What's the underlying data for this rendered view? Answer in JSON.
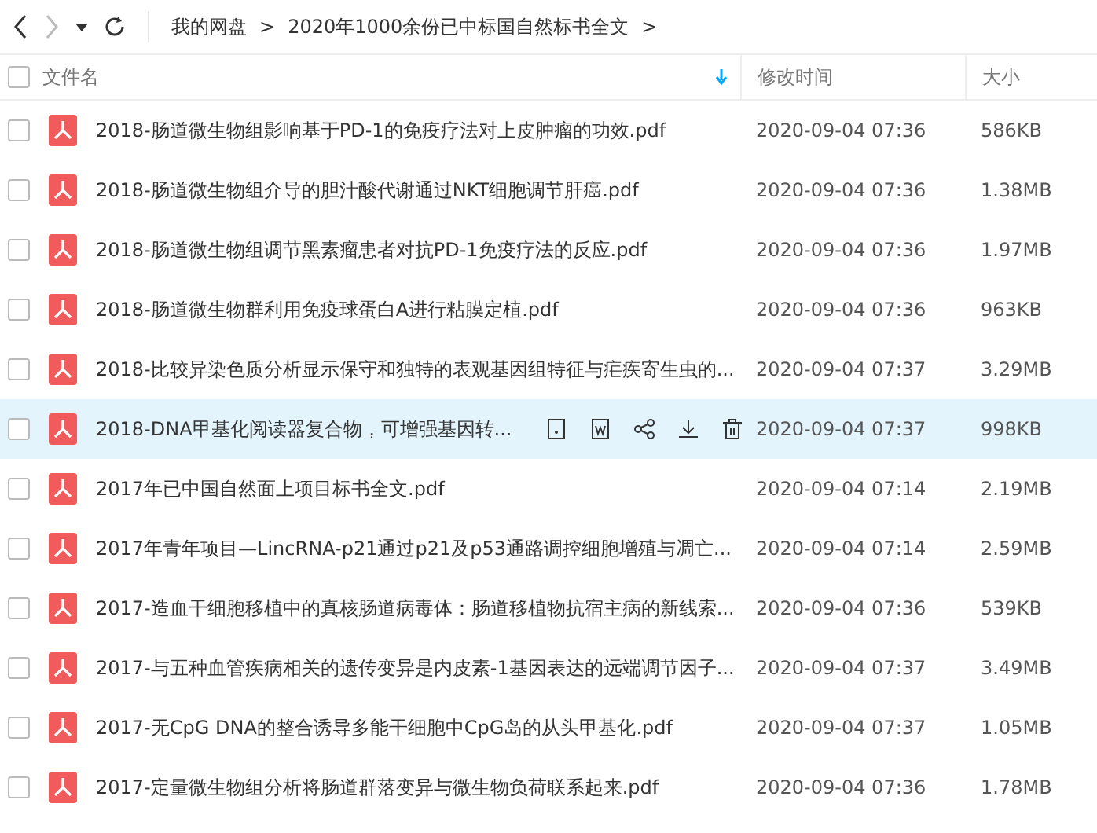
{
  "breadcrumb": [
    {
      "label": "我的网盘",
      "separator": ">"
    },
    {
      "label": "2020年1000余份已中标国自然标书全文",
      "separator": ">"
    }
  ],
  "select_all": {
    "checked": false
  },
  "columns": [
    {
      "label": "文件名",
      "sorted": true
    },
    {
      "label": "修改时间",
      "sorted": false
    },
    {
      "label": "大小",
      "sorted": false
    }
  ],
  "rows": [
    {
      "name": "2018-肠道微生物组影响基于PD-1的免疫疗法对上皮肿瘤的功效.pdf",
      "modified": "2020-09-04 07:36",
      "size": "586KB",
      "selected": false,
      "checked": false
    },
    {
      "name": "2018-肠道微生物组介导的胆汁酸代谢通过NKT细胞调节肝癌.pdf",
      "modified": "2020-09-04 07:36",
      "size": "1.38MB",
      "selected": false,
      "checked": false
    },
    {
      "name": "2018-肠道微生物组调节黑素瘤患者对抗PD-1免疫疗法的反应.pdf",
      "modified": "2020-09-04 07:36",
      "size": "1.97MB",
      "selected": false,
      "checked": false
    },
    {
      "name": "2018-肠道微生物群利用免疫球蛋白A进行粘膜定植.pdf",
      "modified": "2020-09-04 07:36",
      "size": "963KB",
      "selected": false,
      "checked": false
    },
    {
      "name": "2018-比较异染色质分析显示保守和独特的表观基因组特征与疟疾寄生虫的...",
      "modified": "2020-09-04 07:37",
      "size": "3.29MB",
      "selected": false,
      "checked": false
    },
    {
      "name": "2018-DNA甲基化阅读器复合物，可增强基因转...",
      "modified": "2020-09-04 07:37",
      "size": "998KB",
      "selected": true,
      "checked": false
    },
    {
      "name": "2017年已中国自然面上项目标书全文.pdf",
      "modified": "2020-09-04 07:14",
      "size": "2.19MB",
      "selected": false,
      "checked": false
    },
    {
      "name": "2017年青年项目—LincRNA-p21通过p21及p53通路调控细胞增殖与凋亡...",
      "modified": "2020-09-04 07:14",
      "size": "2.59MB",
      "selected": false,
      "checked": false
    },
    {
      "name": "2017-造血干细胞移植中的真核肠道病毒体：肠道移植物抗宿主病的新线索...",
      "modified": "2020-09-04 07:36",
      "size": "539KB",
      "selected": false,
      "checked": false
    },
    {
      "name": "2017-与五种血管疾病相关的遗传变异是内皮素-1基因表达的远端调节因子...",
      "modified": "2020-09-04 07:37",
      "size": "3.49MB",
      "selected": false,
      "checked": false
    },
    {
      "name": "2017-无CpG DNA的整合诱导多能干细胞中CpG岛的从头甲基化.pdf",
      "modified": "2020-09-04 07:37",
      "size": "1.05MB",
      "selected": false,
      "checked": false
    },
    {
      "name": "2017-定量微生物组分析将肠道群落变异与微生物负荷联系起来.pdf",
      "modified": "2020-09-04 07:36",
      "size": "1.78MB",
      "selected": false,
      "checked": false
    }
  ]
}
